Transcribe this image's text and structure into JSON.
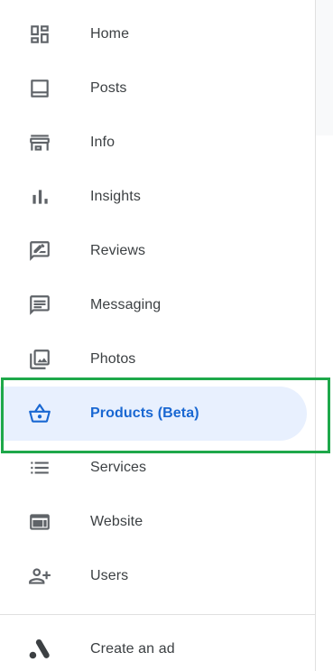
{
  "nav": {
    "items": [
      {
        "label": "Home",
        "icon": "dashboard-icon"
      },
      {
        "label": "Posts",
        "icon": "posts-icon"
      },
      {
        "label": "Info",
        "icon": "storefront-icon"
      },
      {
        "label": "Insights",
        "icon": "bar-chart-icon"
      },
      {
        "label": "Reviews",
        "icon": "rate-review-icon"
      },
      {
        "label": "Messaging",
        "icon": "chat-icon"
      },
      {
        "label": "Photos",
        "icon": "photo-library-icon"
      },
      {
        "label": "Products (Beta)",
        "icon": "basket-icon",
        "active": true
      },
      {
        "label": "Services",
        "icon": "list-icon"
      },
      {
        "label": "Website",
        "icon": "web-icon"
      },
      {
        "label": "Users",
        "icon": "person-add-icon"
      }
    ],
    "create_ad": {
      "label": "Create an ad",
      "icon": "google-ads-icon"
    }
  },
  "colors": {
    "active_text": "#1967d2",
    "active_bg": "#e8f0fe",
    "icon": "#5f6368",
    "highlight_border": "#1ea84a"
  }
}
